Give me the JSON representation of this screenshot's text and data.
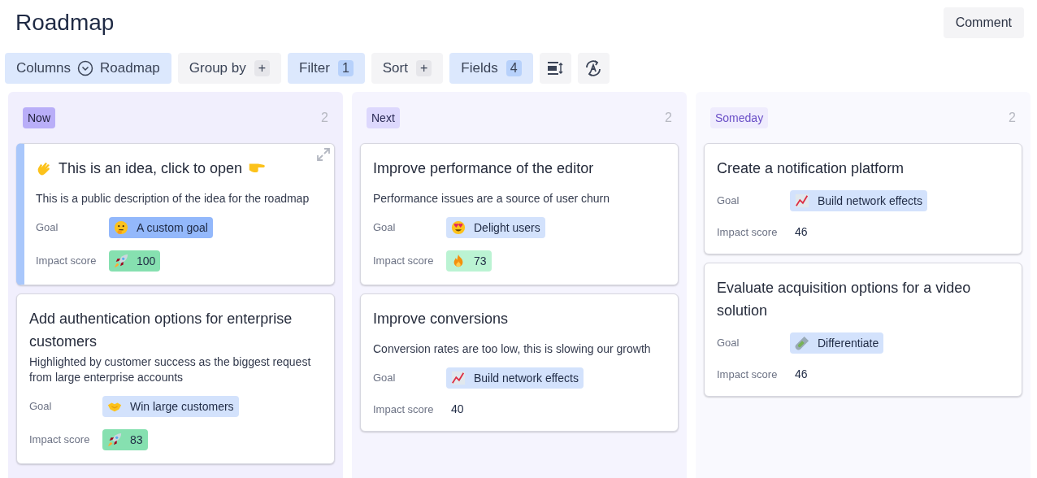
{
  "page": {
    "title": "Roadmap",
    "comment_button": "Comment"
  },
  "toolbar": [
    {
      "kind": "columns",
      "label": "Columns",
      "value": "Roadmap",
      "active": true
    },
    {
      "kind": "badge",
      "label": "Group by",
      "badge": "+",
      "active": false
    },
    {
      "kind": "badge",
      "label": "Filter",
      "badge": "1",
      "active": true
    },
    {
      "kind": "badge",
      "label": "Sort",
      "badge": "+",
      "active": false
    },
    {
      "kind": "badge",
      "label": "Fields",
      "badge": "4",
      "active": true
    },
    {
      "kind": "row-height",
      "active": false
    },
    {
      "kind": "translate",
      "active": false
    }
  ],
  "columns": [
    {
      "label": "Now",
      "color": "#b9aef8",
      "count": "2",
      "cards": [
        {
          "title": "This is an idea, click to open",
          "title_icons": true,
          "selected": true,
          "description": "This is a public description of the idea for the roadmap",
          "goal_label": "Goal",
          "goal": {
            "text": "A custom goal",
            "kind": "thinking",
            "color": "#93b8fb"
          },
          "score_label": "Impact score",
          "score": {
            "text": "100",
            "kind": "rocket",
            "color": "#86e0b0"
          }
        },
        {
          "title": "Add authentication options for enterprise customers",
          "title_icons": false,
          "selected": false,
          "description": "Highlighted by customer success as the biggest request from large enterprise accounts",
          "goal_label": "Goal",
          "goal": {
            "text": "Win large customers",
            "kind": "handshake",
            "color": "#d3e2fc"
          },
          "score_label": "Impact score",
          "score": {
            "text": "83",
            "kind": "rocket",
            "color": "#86e0b0"
          }
        }
      ]
    },
    {
      "label": "Next",
      "color": "#ddd8fd",
      "count": "2",
      "cards": [
        {
          "title": "Improve performance of the editor",
          "title_icons": false,
          "selected": false,
          "description": "Performance issues are a source of user churn",
          "goal_label": "Goal",
          "goal": {
            "text": "Delight users",
            "kind": "heart-eyes",
            "color": "#d3e2fc"
          },
          "score_label": "Impact score",
          "score": {
            "text": "73",
            "kind": "fire",
            "color": "#bbf3d3"
          }
        },
        {
          "title": "Improve conversions",
          "title_icons": false,
          "selected": false,
          "description": "Conversion rates are too low, this is slowing our growth",
          "goal_label": "Goal",
          "goal": {
            "text": "Build network effects",
            "kind": "chart",
            "color": "#d3e2fc"
          },
          "score_label": "Impact score",
          "score": {
            "text": "40",
            "kind": "plain"
          }
        }
      ]
    },
    {
      "label": "Someday",
      "color": "#efecfd",
      "count": "2",
      "cards": [
        {
          "title": "Create a notification platform",
          "title_icons": false,
          "selected": false,
          "goal_label": "Goal",
          "goal": {
            "text": "Build network effects",
            "kind": "chart",
            "color": "#d3e2fc"
          },
          "score_label": "Impact score",
          "score": {
            "text": "46",
            "kind": "plain"
          }
        },
        {
          "title": "Evaluate acquisition options for a video solution",
          "title_icons": false,
          "selected": false,
          "goal_label": "Goal",
          "goal": {
            "text": "Differentiate",
            "kind": "test-tube",
            "color": "#d3e2fc"
          },
          "score_label": "Impact score",
          "score": {
            "text": "46",
            "kind": "plain"
          }
        }
      ]
    }
  ]
}
